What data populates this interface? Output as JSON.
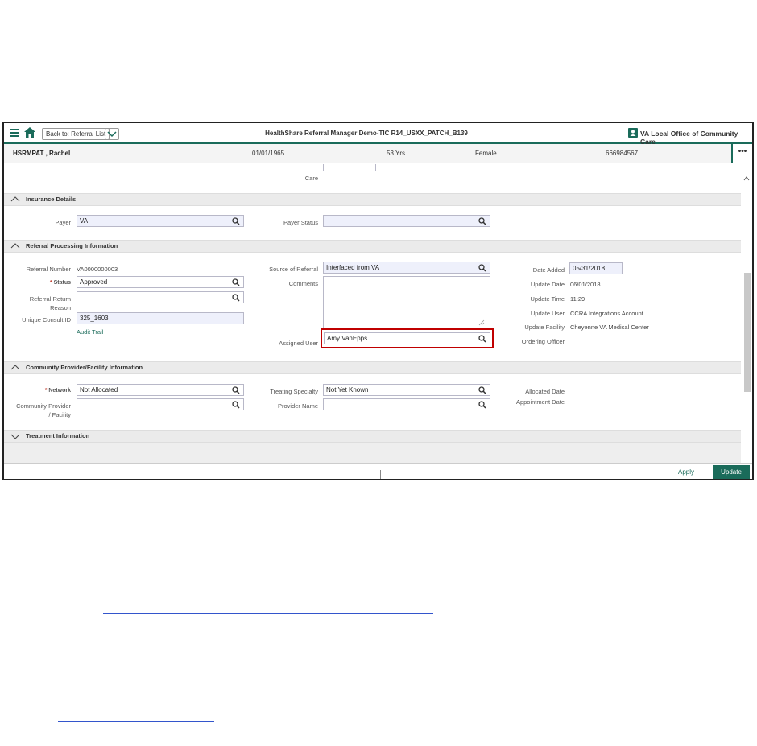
{
  "app": {
    "title": "HealthShare Referral Manager Demo-TIC R14_USXX_PATCH_B139",
    "back_label": "Back to: Referral List",
    "office_label": "VA Local Office of Community Care"
  },
  "patient": {
    "name": "HSRMPAT , Rachel",
    "dob": "01/01/1965",
    "age": "53 Yrs",
    "gender": "Female",
    "id": "666984567",
    "more_label": "•••"
  },
  "partial_row": {
    "label": "Care"
  },
  "insurance": {
    "header": "Insurance Details",
    "payer_label": "Payer",
    "payer_value": "VA",
    "payer_status_label": "Payer Status",
    "payer_status_value": ""
  },
  "referral": {
    "header": "Referral Processing Information",
    "referral_number_label": "Referral Number",
    "referral_number_value": "VA0000000003",
    "status_label": "Status",
    "status_value": "Approved",
    "return_reason_label": "Referral Return Reason",
    "return_reason_value": "",
    "consult_id_label": "Unique Consult ID",
    "consult_id_value": "325_1603",
    "audit_trail_label": "Audit Trail",
    "source_label": "Source of Referral",
    "source_value": "Interfaced from VA",
    "comments_label": "Comments",
    "comments_value": "",
    "assigned_user_label": "Assigned User",
    "assigned_user_value": "Amy VanEpps",
    "date_added_label": "Date Added",
    "date_added_value": "05/31/2018",
    "update_date_label": "Update Date",
    "update_date_value": "06/01/2018",
    "update_time_label": "Update Time",
    "update_time_value": "11:29",
    "update_user_label": "Update User",
    "update_user_value": "CCRA Integrations Account",
    "update_facility_label": "Update Facility",
    "update_facility_value": "Cheyenne VA Medical Center",
    "ordering_officer_label": "Ordering Officer"
  },
  "provider": {
    "header": "Community Provider/Facility Information",
    "network_label": "Network",
    "network_value": "Not Allocated",
    "community_label": "Community Provider / Facility",
    "community_value": "",
    "specialty_label": "Treating Specialty",
    "specialty_value": "Not Yet Known",
    "provider_name_label": "Provider Name",
    "provider_name_value": "",
    "allocated_date_label": "Allocated Date",
    "appointment_date_label": "Appointment Date"
  },
  "treatment": {
    "header": "Treatment Information"
  },
  "footer": {
    "apply_label": "Apply",
    "update_label": "Update"
  },
  "colors": {
    "accent": "#1a6b5a",
    "highlight": "#c00000",
    "field_bg": "#eef0fb"
  },
  "icons": [
    "hamburger-icon",
    "home-icon",
    "chevron-down-icon",
    "person-card-icon",
    "search-icon",
    "chevron-up-icon"
  ]
}
